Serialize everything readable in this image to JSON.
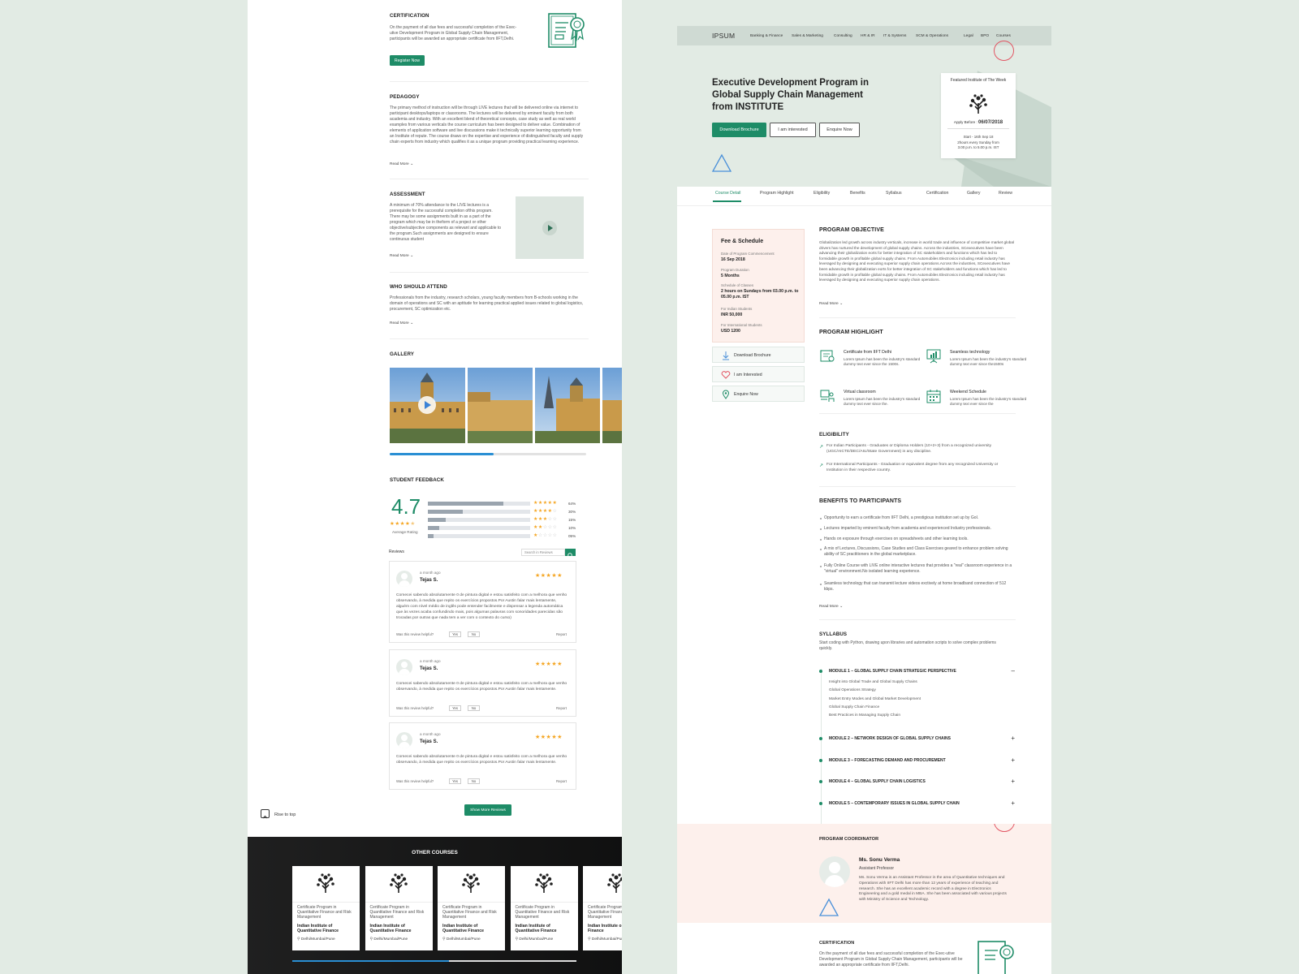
{
  "left": {
    "certification": {
      "title": "CERTIFICATION",
      "text": "On the payment of all due fees and successful completion of the Exec-utive Development Program in Global Supply Chain Management, participants will be awarded an appropriate certificate from IIFT,Delhi.",
      "button": "Register Now"
    },
    "pedagogy": {
      "title": "PEDAGOGY",
      "text": "The primary method of instruction will be through LIVE lectures that will be delivered online via internet to participant desktops/laptops or classrooms. The lectures will be delivered by eminent faculty from both academia and industry. With an excellent blend of theoretical concepts, case study as well as real world examples from various verticals the course curriculum has been designed to deliver value. Combination of elements of application software and live discussions make it technically superior learning opportunity from an Institute of repute. The course draws on the expertise and experience of distinguished faculty and supply chain experts from industry which qualifies it as a unique program providing practical learning experience.",
      "read_more": "Read More"
    },
    "assessment": {
      "title": "ASSESSMENT",
      "text": "A minimum of 70% attendance to the LIVE lectures is a prerequisite for the successful completion ofthis program. There may be some assignments built in as a part of the program which may be in theform of a project or other objective/subjective components as relevant and applicable to the program.Such assignments are designed to ensure continuous student",
      "read_more": "Read More"
    },
    "who": {
      "title": "WHO SHOULD ATTEND",
      "text": "Professionals from the industry, research scholars, young faculty members from B-schools working in the domain of operations and SC with an aptitude for learning practical applied issues related to global logistics, procurement, SC optimization etc.",
      "read_more": "Read More"
    },
    "gallery": {
      "title": "GALLERY",
      "progress": 0.53
    },
    "feedback": {
      "title": "STUDENT FEEDBACK",
      "rating": "4.7",
      "rating_value": 4.7,
      "average_label": "Average Rating",
      "distribution": [
        {
          "stars": 5,
          "label": "64%",
          "value": 0.64
        },
        {
          "stars": 4,
          "label": "30%",
          "value": 0.3
        },
        {
          "stars": 3,
          "label": "15%",
          "value": 0.15
        },
        {
          "stars": 2,
          "label": "10%",
          "value": 0.1
        },
        {
          "stars": 1,
          "label": "05%",
          "value": 0.05
        }
      ],
      "reviews_label": "Reviews",
      "search_placeholder": "Search in Reviews",
      "helpful_label": "Was this review helpful?",
      "yes": "Yes",
      "no": "No",
      "report": "Report",
      "reviews": [
        {
          "time": "a month ago",
          "name": "Tejas S.",
          "rating": 5,
          "text": "Comecei sabendo absolutamente 0 de pintura digital e estou satisfeito com a melhora que venho observando, à medida que repito os exercícios propostos.Por Austin falar mais lentamente, alguém com nível médio de inglês pode entender facilmente e dispensar a legenda automática que às vezes acaba confundindo mais, pois algumas palavras com sonoridades parecidas são trocadas por outras que nada tem a ver com o contexto do curso)"
        },
        {
          "time": "a month ago",
          "name": "Tejas S.",
          "rating": 5,
          "text": "Comecei sabendo absolutamente 0 de pintura digital e estou satisfeito com a melhora que venho observando, à medida que repito os exercícios propostos.Por Austin falar mais lentamente."
        },
        {
          "time": "a month ago",
          "name": "Tejas S.",
          "rating": 5,
          "text": "Comecei sabendo absolutamente 0 de pintura digital e estou satisfeito com a melhora que venho observando, à medida que repito os exercícios propostos.Por Austin falar mais lentamente."
        }
      ],
      "show_more": "Show More Reviews"
    },
    "rise_to_top": "Rise to top",
    "other_courses": {
      "title": "OTHER COURSES",
      "progress": 0.55,
      "items": [
        {
          "title": "Certificate Program in Quantitative Finance and Risk Management",
          "institute": "Indian Institute of Quantitative Finance",
          "location": "Delhi/Mumbai/Pune"
        },
        {
          "title": "Certificate Program in Quantitative Finance and Risk Management",
          "institute": "Indian Institute of Quantitative Finance",
          "location": "Delhi/Mumbai/Pune"
        },
        {
          "title": "Certificate Program in Quantitative Finance and Risk Management",
          "institute": "Indian Institute of Quantitative Finance",
          "location": "Delhi/Mumbai/Pune"
        },
        {
          "title": "Certificate Program in Quantitative Finance and Risk Management",
          "institute": "Indian Institute of Quantitative Finance",
          "location": "Delhi/Mumbai/Pune"
        },
        {
          "title": "Certificate Program in Quantitative Finance and Risk Management",
          "institute": "Indian Institute o Quantitative Finance",
          "location": "Delhi/Mumbai/Pune"
        }
      ]
    }
  },
  "right": {
    "brand": "IPSUM",
    "nav": [
      "Banking & Finance",
      "Sales & Marketing",
      "Consulting",
      "HR & IR",
      "IT & Systems",
      "SCM & Operations",
      "Legal",
      "BPO",
      "Courses"
    ],
    "hero": {
      "title": "Executive Development Program in Global Supply Chain Management from INSTITUTE",
      "download": "Download Brochure",
      "interested": "I am interested",
      "enquire": "Enquire Now",
      "card_title": "Featured Institute of The Week",
      "apply_label": "Apply Before :",
      "apply_date": "06/07/2018",
      "schedule": "Start - 16th Sep 18",
      "hours": "2hours every Sunday from",
      "time": "3.00 p.m. to 5.00 p.m. IST"
    },
    "tabs": [
      "Course Detail",
      "Program Highlight",
      "Eligibility",
      "Benefits",
      "Syllabus",
      "Certification",
      "Gallery",
      "Review"
    ],
    "fee": {
      "title": "Fee & Schedule",
      "rows": [
        {
          "label": "Date of Program Commencement",
          "value": "16 Sep 2018"
        },
        {
          "label": "Program Duration",
          "value": "5 Months"
        },
        {
          "label": "Schedule of Classes",
          "value": "2 hours on Sundays from 03.00 p.m. to 05.00 p.m. IST"
        },
        {
          "label": "For Indian Students",
          "value": "INR 50,000"
        },
        {
          "label": "For International Students",
          "value": "USD 1200"
        }
      ]
    },
    "side_actions": [
      "Download Brochure",
      "I am Interested",
      "Enquire Now"
    ],
    "objective": {
      "title": "PROGRAM OBJECTIVE",
      "text": "Globalization led growth across industry verticals, increase in world trade and influence of competitive market global drivers has nurtured the development of global supply chains. Across the industries, SCexecutives have been advancing their globalization eorts for better integration of SC stakeholders and functions which has led to formidable growth in profitable global supply chains. From Automobiles Electronics including retail industry has leveraged by designing and executing superior supply chain operations.Across the industries, SCexecutives have been advancing their globalization eorts for better integration of SC stakeholders and functions which has led to formidable growth in profitable global supply chains. From Automobiles Electronics including retail industry has leveraged by designing and executing superior supply chain operations.",
      "read_more": "Read More"
    },
    "highlight": {
      "title": "PROGRAM HIGHLIGHT",
      "items": [
        {
          "title": "Certificate from IIFT Delhi",
          "text": "Lorem Ipsum has been the industry's standard dummy text ever since the 1500s."
        },
        {
          "title": "Seamless technology",
          "text": "Lorem Ipsum has been the industry's standard dummy text ever since the1500s"
        },
        {
          "title": "Virtual classroom",
          "text": "Lorem Ipsum has been the industry's standard dummy text ever since the."
        },
        {
          "title": "Weekend Schedule",
          "text": "Lorem Ipsum has been the industry's standard dummy text ever since the"
        }
      ]
    },
    "eligibility": {
      "title": "ELIGIBILITY",
      "items": [
        "For Indian Participants - Graduates or Diploma Holders (10+2+3) from a recognized university (UGC/AICTE/DEC/AIU/State Government) in any discipline.",
        "For International Participants - Graduation or equivalent degree from any recognized University or Institution in their respective country."
      ]
    },
    "benefits": {
      "title": "BENEFITS TO PARTICIPANTS",
      "items": [
        "Opportunity to earn a certificate from IIFT Delhi, a prestigious institution set up by GoI.",
        "Lectures imparted by eminent faculty from academia and experienced Industry professionals.",
        "Hands on exposure through exercises on spreadsheets and other learning tools.",
        "A mix of Lectures, Discussions, Case Studies and Class Exercises geared to enhance problem solving ability of SC practitioners in the global marketplace.",
        "Fully Online Course with LIVE online interactive lectures that provides a \"real\" classroom experience in a \"virtual\" environment.No isolated learning experience.",
        "Seamless technology that can transmit lecture videos exctively at home broadband connection of 512 kbps."
      ],
      "read_more": "Read More"
    },
    "syllabus": {
      "title": "SYLLABUS",
      "intro": "Start coding with Python, drawing upon libraries and automation scripts to solve complex problems quickly.",
      "modules": [
        {
          "title": "MODULE 1 – GLOBAL SUPPLY CHAIN STRATEGIC PERSPECTIVE",
          "toggle": "–"
        },
        {
          "title": "MODULE 2 – NETWORK DESIGN OF GLOBAL SUPPLY CHAINS",
          "toggle": "+"
        },
        {
          "title": "MODULE 3 – FORECASTING DEMAND AND PROCUREMENT",
          "toggle": "+"
        },
        {
          "title": "MODULE 4 – GLOBAL SUPPLY CHAIN LOGISTICS",
          "toggle": "+"
        },
        {
          "title": "MODULE 5 – CONTEMPORARY ISSUES IN GLOBAL SUPPLY CHAIN",
          "toggle": "+"
        }
      ],
      "module1_topics": [
        "Insight into Global Trade and Global Supply Chains",
        "Global Operations Strategy",
        "Market Entry Modes and Global Market Development",
        "Global Supply Chain Finance",
        "Best Practices in Managing Supply Chain"
      ]
    },
    "coordinator": {
      "title": "PROGRAM COORDINATOR",
      "name": "Ms. Sonu Verma",
      "role": "Assistant Professor",
      "bio": "Ms. Sonu Verma is an Assistant Professor in the area of Quantitative techniques and Operations with IIFT Delhi has more than 12 years of experience of teaching and research. She has an excellent academic record with a degree in Electronics Engineering and a gold medal in MBA. She has been associated with various projects with Ministry of Science and Technology."
    },
    "certification": {
      "title": "CERTIFICATION",
      "text": "On the payment of all due fees and successful completion of the Exec-utive Development Program in Global Supply Chain Management, participants will be awarded an appropriate certificate from IIFT,Delhi."
    }
  },
  "colors": {
    "accent": "#1e8c67",
    "pink": "#fdf0ec",
    "hero_bg": "#e2ebe4",
    "footer_bg": "#151617"
  }
}
